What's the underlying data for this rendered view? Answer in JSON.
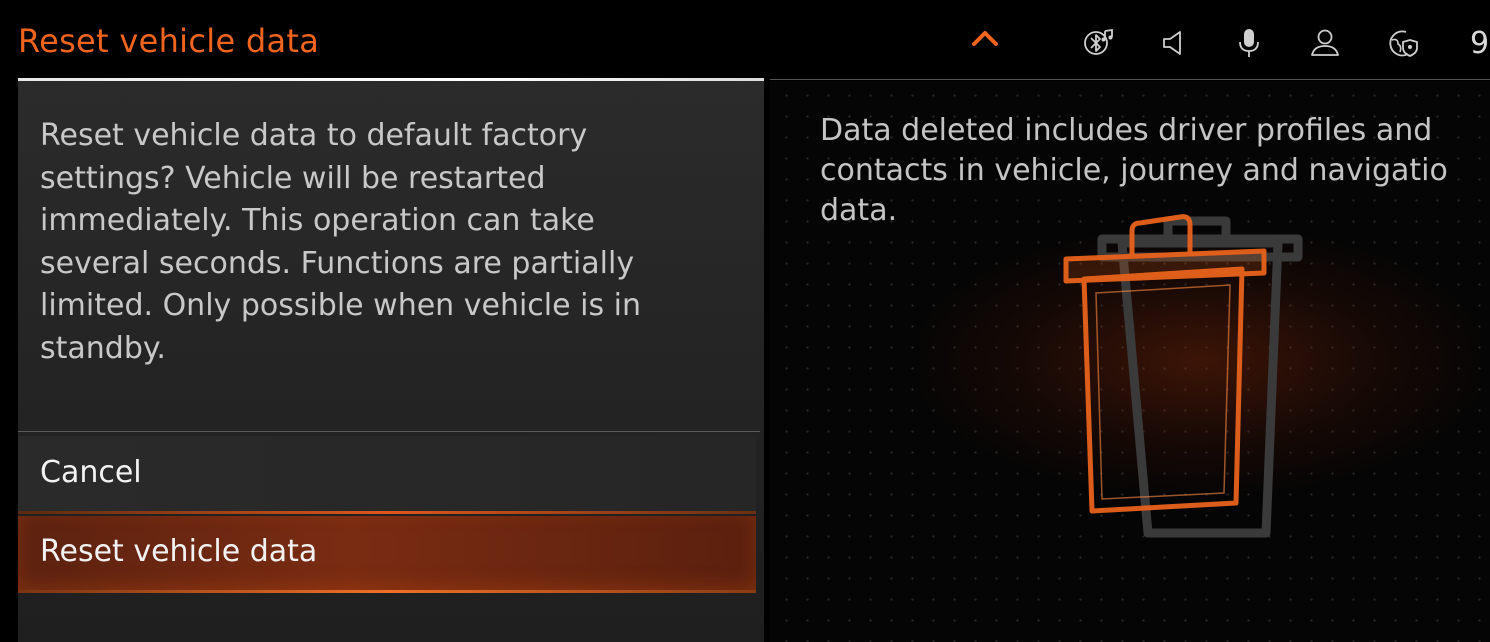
{
  "header": {
    "title": "Reset vehicle data",
    "clock_partial": "9",
    "icons": [
      "chevron-up-icon",
      "bluetooth-audio-icon",
      "speaker-icon",
      "microphone-icon",
      "user-profile-icon",
      "connectivity-globe-icon"
    ]
  },
  "dialog": {
    "message_lines": [
      "Reset vehicle data to default factory",
      "settings? Vehicle will be restarted",
      "immediately. This operation can take",
      "several seconds. Functions are partially",
      "limited. Only possible when vehicle is in",
      "standby."
    ],
    "cancel_label": "Cancel",
    "reset_label": "Reset vehicle data"
  },
  "info": {
    "description_lines": [
      "Data deleted includes driver profiles and",
      "contacts in vehicle, journey and navigatio",
      "data."
    ],
    "illustration": "trash-can-icon"
  },
  "colors": {
    "accent": "#f0641e",
    "selected_row": "#7a2c12",
    "text": "#c8c8c8",
    "background": "#000000"
  }
}
